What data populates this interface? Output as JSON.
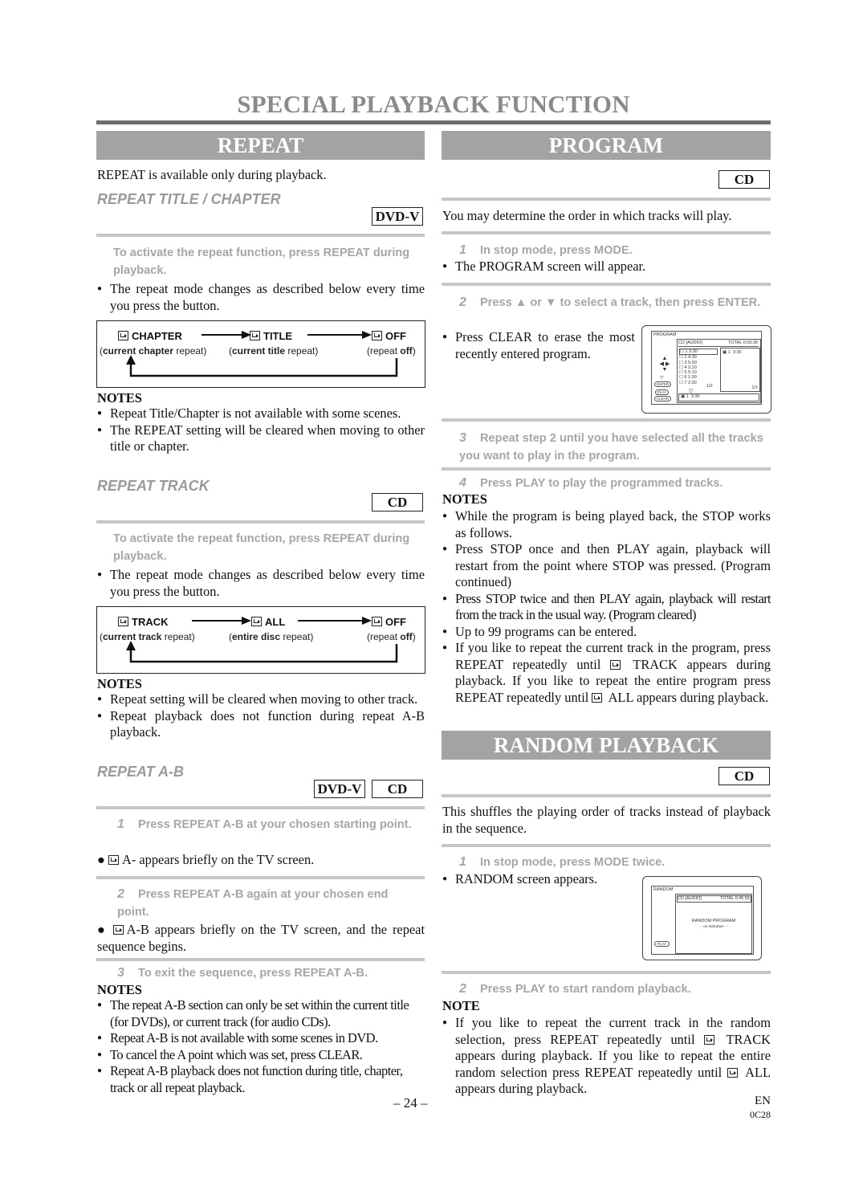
{
  "page_title": "SPECIAL PLAYBACK FUNCTION",
  "left": {
    "banner": "REPEAT",
    "intro": "REPEAT is available only during playback.",
    "title_chapter": {
      "heading": "REPEAT TITLE / CHAPTER",
      "badge": "DVD-V",
      "step": "To activate the repeat function, press REPEAT during playback.",
      "bullet": "The repeat mode changes as described below every time you press the button.",
      "diagram": [
        {
          "label": "CHAPTER",
          "sub_bold": "current chapter",
          "sub_rest": " repeat"
        },
        {
          "label": "TITLE",
          "sub_bold": "current title",
          "sub_rest": " repeat"
        },
        {
          "label": "OFF",
          "sub_pre": "repeat ",
          "sub_bold": "off"
        }
      ],
      "notes_heading": "NOTES",
      "notes": [
        "Repeat Title/Chapter is not available with some scenes.",
        "The REPEAT setting will be cleared when moving to other title or chapter."
      ]
    },
    "track": {
      "heading": "REPEAT TRACK",
      "badge": "CD",
      "step": "To activate the repeat function, press REPEAT during playback.",
      "bullet": "The repeat mode changes as described below every time you press the button.",
      "diagram": [
        {
          "label": "TRACK",
          "sub_bold": "current track",
          "sub_rest": " repeat"
        },
        {
          "label": "ALL",
          "sub_bold": "entire disc",
          "sub_rest": " repeat"
        },
        {
          "label": "OFF",
          "sub_pre": "repeat ",
          "sub_bold": "off"
        }
      ],
      "notes_heading": "NOTES",
      "notes": [
        "Repeat setting will be cleared when moving to other track.",
        "Repeat playback does not function during repeat A-B playback."
      ]
    },
    "ab": {
      "heading": "REPEAT A-B",
      "badges": [
        "DVD-V",
        "CD"
      ],
      "steps": [
        {
          "num": "1",
          "text": "Press REPEAT A-B at your chosen starting point.",
          "bullet": "A- appears briefly on the TV screen."
        },
        {
          "num": "2",
          "text": "Press REPEAT A-B again at your chosen end point.",
          "bullet": "A-B appears briefly on the TV screen, and the repeat sequence begins."
        },
        {
          "num": "3",
          "text": "To exit the sequence, press REPEAT A-B."
        }
      ],
      "notes_heading": "NOTES",
      "notes": [
        "The repeat A-B section can only be set within the current title (for DVDs), or current track (for audio CDs).",
        "Repeat A-B is not available with some scenes in DVD.",
        "To cancel the A point which was set, press CLEAR.",
        "Repeat A-B playback does not function during title, chapter, track or all repeat playback."
      ]
    }
  },
  "right": {
    "program": {
      "banner": "PROGRAM",
      "badge": "CD",
      "intro": "You may determine the order in which tracks will play.",
      "steps": [
        {
          "num": "1",
          "text": "In stop mode, press MODE.",
          "bullet": "The PROGRAM screen will appear."
        },
        {
          "num": "2",
          "text": "Press ▲ or ▼ to select a track, then press ENTER.",
          "bullet": "Press CLEAR to erase the most recently entered program."
        },
        {
          "num": "3",
          "text": "Repeat step 2 until you have selected all the tracks you want to play in the program."
        },
        {
          "num": "4",
          "text": "Press PLAY to play the programmed tracks."
        }
      ],
      "screen": {
        "title": "PROGRAM",
        "header_left": "CD [AUDIO]",
        "header_right": "TOTAL 0:03:30",
        "tracks": [
          {
            "n": "1",
            "t": "3:30"
          },
          {
            "n": "2",
            "t": "4:30"
          },
          {
            "n": "3",
            "t": "5:00"
          },
          {
            "n": "4",
            "t": "3:10"
          },
          {
            "n": "5",
            "t": "5:10"
          },
          {
            "n": "6",
            "t": "1:30"
          },
          {
            "n": "7",
            "t": "2:30"
          }
        ],
        "list_page": "1/2",
        "program_list": [
          {
            "n": "1",
            "t": "3:30"
          }
        ],
        "program_page": "1/1",
        "bottom": {
          "n": "1",
          "t": "3:30"
        },
        "buttons": [
          "ENTER",
          "PLAY",
          "CLEAR"
        ]
      },
      "notes_heading": "NOTES",
      "notes": [
        "While the program is being played back, the STOP works as follows.",
        "Press STOP once and then PLAY again, playback will restart from the point where STOP was pressed. (Program continued)",
        "Press STOP twice and then PLAY again, playback will restart from the track in the usual way. (Program cleared)",
        "Up to 99 programs can be entered.",
        "If you like to repeat the current track in the program, press REPEAT repeatedly until [R] TRACK appears during playback. If you like to repeat the entire program press REPEAT repeatedly until [R] ALL appears during playback."
      ]
    },
    "random": {
      "banner": "RANDOM PLAYBACK",
      "badge": "CD",
      "intro": "This shuffles the playing order of tracks instead of playback in the sequence.",
      "steps": [
        {
          "num": "1",
          "text": "In stop mode, press MODE twice.",
          "bullet": "RANDOM screen appears."
        },
        {
          "num": "2",
          "text": "Press PLAY to start random playback."
        }
      ],
      "screen": {
        "title": "RANDOM",
        "header_left": "CD [AUDIO]",
        "header_right": "TOTAL 0:45:55",
        "center_line1": "RANDOM PROGRAM",
        "center_line2": "- - no indication - -",
        "button": "PLAY"
      },
      "note_heading": "NOTE",
      "note": "If you like to repeat the current track in the random selection, press REPEAT repeatedly until [R] TRACK appears during playback. If you like to repeat the entire random selection press REPEAT repeatedly until [R] ALL appears during playback."
    }
  },
  "footer": {
    "page": "– 24 –",
    "lang": "EN",
    "code": "0C28"
  }
}
